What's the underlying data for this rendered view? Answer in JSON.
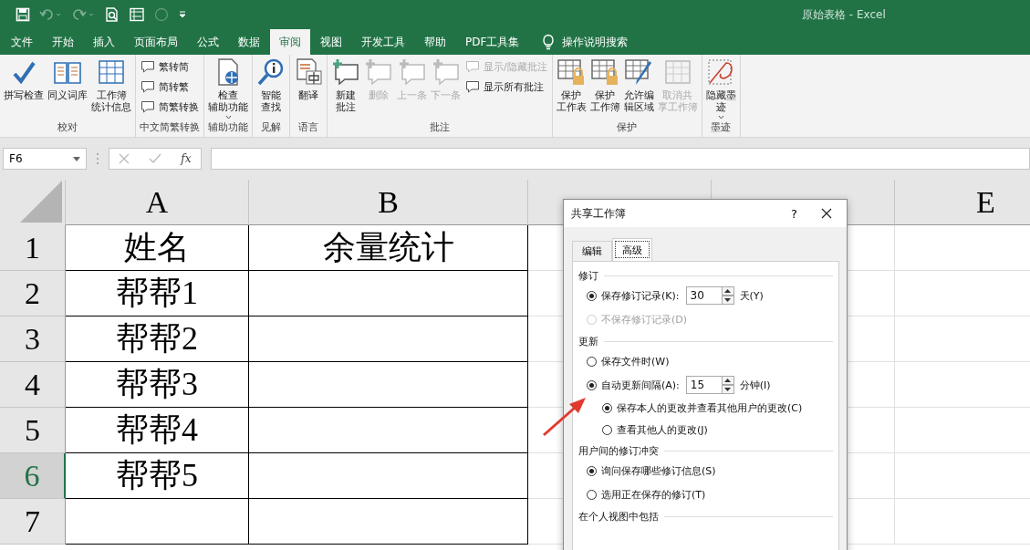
{
  "window": {
    "title": "原始表格  -  Excel"
  },
  "menu_tabs": [
    {
      "label": "文件",
      "selected": false
    },
    {
      "label": "开始",
      "selected": false
    },
    {
      "label": "插入",
      "selected": false
    },
    {
      "label": "页面布局",
      "selected": false
    },
    {
      "label": "公式",
      "selected": false
    },
    {
      "label": "数据",
      "selected": false
    },
    {
      "label": "审阅",
      "selected": true
    },
    {
      "label": "视图",
      "selected": false
    },
    {
      "label": "开发工具",
      "selected": false
    },
    {
      "label": "帮助",
      "selected": false
    },
    {
      "label": "PDF工具集",
      "selected": false
    }
  ],
  "tell_me": {
    "label": "操作说明搜索"
  },
  "ribbon": {
    "groups": [
      {
        "label": "校对",
        "items": [
          {
            "kind": "large",
            "lines": [
              "拼写检查"
            ],
            "disabled": false,
            "dropdown": false
          },
          {
            "kind": "large",
            "lines": [
              "同义词库"
            ],
            "disabled": false,
            "dropdown": false
          },
          {
            "kind": "large",
            "lines": [
              "工作簿",
              "统计信息"
            ],
            "disabled": false,
            "dropdown": false
          }
        ]
      },
      {
        "label": "中文简繁转换",
        "items": [
          {
            "kind": "stack",
            "rows": [
              {
                "label": "繁转简",
                "disabled": false
              },
              {
                "label": "简转繁",
                "disabled": false
              },
              {
                "label": "简繁转换",
                "disabled": false
              }
            ]
          }
        ]
      },
      {
        "label": "辅助功能",
        "items": [
          {
            "kind": "large",
            "lines": [
              "检查",
              "辅助功能"
            ],
            "disabled": false,
            "dropdown": true
          }
        ]
      },
      {
        "label": "见解",
        "items": [
          {
            "kind": "large",
            "lines": [
              "智能",
              "查找"
            ],
            "disabled": false,
            "dropdown": false
          }
        ]
      },
      {
        "label": "语言",
        "items": [
          {
            "kind": "large",
            "lines": [
              "翻译"
            ],
            "disabled": false,
            "dropdown": false
          }
        ]
      },
      {
        "label": "批注",
        "items": [
          {
            "kind": "large",
            "lines": [
              "新建",
              "批注"
            ],
            "disabled": false,
            "dropdown": false
          },
          {
            "kind": "large",
            "lines": [
              "删除"
            ],
            "disabled": true,
            "dropdown": false
          },
          {
            "kind": "large",
            "lines": [
              "上一条"
            ],
            "disabled": true,
            "dropdown": false
          },
          {
            "kind": "large",
            "lines": [
              "下一条"
            ],
            "disabled": true,
            "dropdown": false
          },
          {
            "kind": "stack",
            "rows": [
              {
                "label": "显示/隐藏批注",
                "disabled": true
              },
              {
                "label": "显示所有批注",
                "disabled": false
              }
            ]
          }
        ]
      },
      {
        "label": "保护",
        "items": [
          {
            "kind": "large",
            "lines": [
              "保护",
              "工作表"
            ],
            "disabled": false,
            "dropdown": false
          },
          {
            "kind": "large",
            "lines": [
              "保护",
              "工作簿"
            ],
            "disabled": false,
            "dropdown": false
          },
          {
            "kind": "large",
            "lines": [
              "允许编",
              "辑区域"
            ],
            "disabled": false,
            "dropdown": false
          },
          {
            "kind": "large",
            "lines": [
              "取消共",
              "享工作簿"
            ],
            "disabled": true,
            "dropdown": false
          }
        ]
      },
      {
        "label": "墨迹",
        "items": [
          {
            "kind": "large",
            "lines": [
              "隐藏墨",
              "迹"
            ],
            "disabled": false,
            "dropdown": true
          }
        ]
      }
    ]
  },
  "formula_bar": {
    "name_box": "F6",
    "fx": "fx"
  },
  "sheet": {
    "columns": [
      {
        "label": "A",
        "covered": false
      },
      {
        "label": "B",
        "covered": false
      },
      {
        "covered": true
      },
      {
        "covered": true
      },
      {
        "label": "E",
        "covered": false
      }
    ],
    "rows": [
      {
        "number": "1",
        "selected": false,
        "cells": [
          "姓名",
          "余量统计"
        ]
      },
      {
        "number": "2",
        "selected": false,
        "cells": [
          "帮帮1",
          ""
        ]
      },
      {
        "number": "3",
        "selected": false,
        "cells": [
          "帮帮2",
          ""
        ]
      },
      {
        "number": "4",
        "selected": false,
        "cells": [
          "帮帮3",
          ""
        ]
      },
      {
        "number": "5",
        "selected": false,
        "cells": [
          "帮帮4",
          ""
        ]
      },
      {
        "number": "6",
        "selected": true,
        "cells": [
          "帮帮5",
          ""
        ]
      },
      {
        "number": "7",
        "selected": false,
        "cells": [
          "",
          ""
        ]
      }
    ]
  },
  "dialog": {
    "title": "共享工作簿",
    "help": "?",
    "tabs": [
      {
        "label": "编辑",
        "selected": false
      },
      {
        "label": "高级",
        "selected": true
      }
    ],
    "sections": [
      {
        "title": "修订",
        "options": [
          {
            "label": "保存修订记录(K):",
            "selected": true,
            "disabled": false,
            "spin": "30",
            "unit": "天(Y)"
          },
          {
            "label": "不保存修订记录(D)",
            "selected": false,
            "disabled": true
          }
        ]
      },
      {
        "title": "更新",
        "options": [
          {
            "label": "保存文件时(W)",
            "selected": false,
            "disabled": false
          },
          {
            "label": "自动更新间隔(A):",
            "selected": true,
            "disabled": false,
            "spin": "15",
            "unit": "分钟(I)",
            "children": [
              {
                "label": "保存本人的更改并查看其他用户的更改(C)",
                "selected": true,
                "disabled": false
              },
              {
                "label": "查看其他人的更改(J)",
                "selected": false,
                "disabled": false
              }
            ]
          }
        ]
      },
      {
        "title": "用户间的修订冲突",
        "options": [
          {
            "label": "询问保存哪些修订信息(S)",
            "selected": true,
            "disabled": false
          },
          {
            "label": "选用正在保存的修订(T)",
            "selected": false,
            "disabled": false
          }
        ]
      },
      {
        "title": "在个人视图中包括"
      }
    ]
  }
}
